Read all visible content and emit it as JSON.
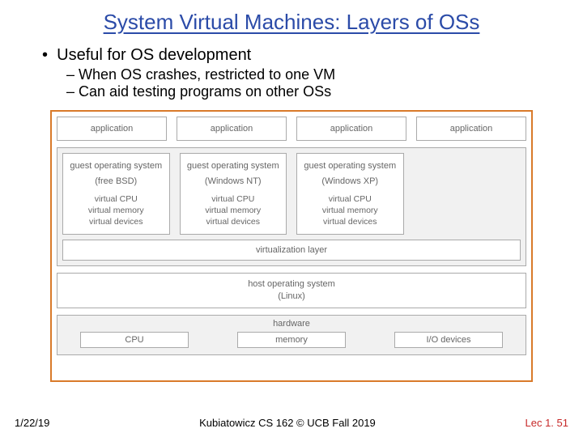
{
  "title": "System Virtual Machines: Layers of OSs",
  "bullets": {
    "main": "Useful for OS development",
    "sub1": "When OS crashes, restricted to one VM",
    "sub2": "Can aid testing programs on other OSs"
  },
  "diagram": {
    "app": "application",
    "guest_title": "guest operating system",
    "os_names": [
      "(free BSD)",
      "(Windows NT)",
      "(Windows XP)"
    ],
    "vcpu": "virtual CPU",
    "vmem": "virtual memory",
    "vdev": "virtual devices",
    "virt_layer": "virtualization layer",
    "host_os": "host operating system",
    "host_os_name": "(Linux)",
    "hardware": "hardware",
    "hw_cpu": "CPU",
    "hw_mem": "memory",
    "hw_io": "I/O devices"
  },
  "footer": {
    "date": "1/22/19",
    "center": "Kubiatowicz CS 162 © UCB Fall 2019",
    "lec": "Lec 1. 51"
  }
}
